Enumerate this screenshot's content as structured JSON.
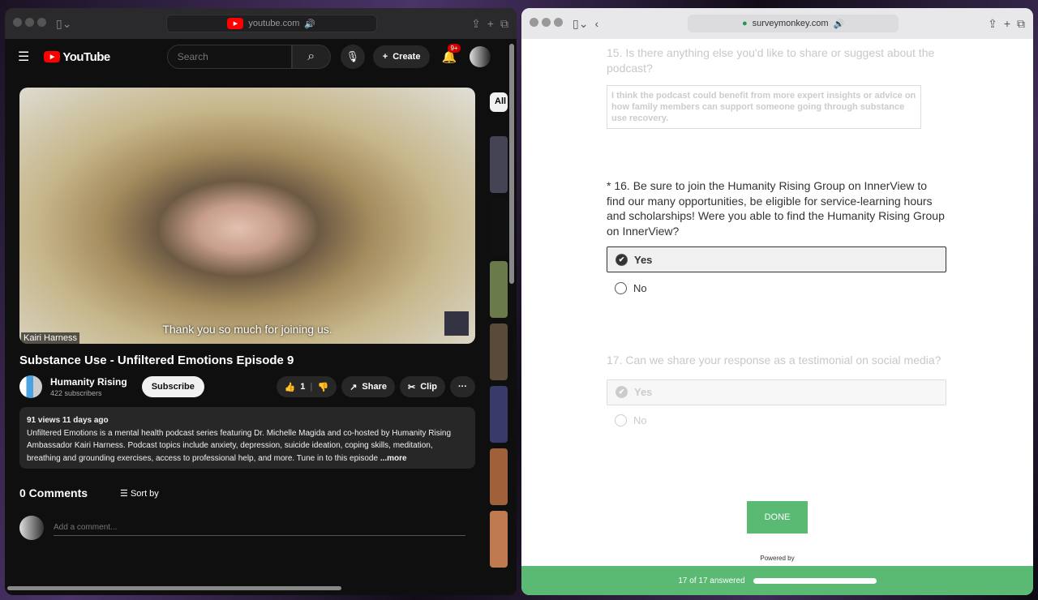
{
  "youtube_window": {
    "url": "youtube.com",
    "logo": "YouTube",
    "search_placeholder": "Search",
    "create": "Create",
    "notif_count": "9+",
    "video": {
      "caption": "Thank you so much for joining us.",
      "name_tag": "Kairi Harness",
      "title": "Substance Use - Unfiltered Emotions Episode 9"
    },
    "channel": {
      "name": "Humanity Rising",
      "subscribers": "422 subscribers",
      "subscribe": "Subscribe"
    },
    "actions": {
      "likes": "1",
      "share": "Share",
      "clip": "Clip",
      "more": "···"
    },
    "description": {
      "meta": "91 views  11 days ago",
      "text": "Unfiltered Emotions is a mental health podcast series featuring Dr. Michelle Magida and co-hosted by Humanity Rising Ambassador Kairi Harness. Podcast topics include anxiety, depression, suicide ideation, coping skills, meditation, breathing and grounding exercises, access to professional help, and more. Tune in to this episode",
      "more": "...more"
    },
    "comments": {
      "count": "0 Comments",
      "sort": "Sort by",
      "placeholder": "Add a comment..."
    },
    "sidebar": {
      "chip": "All"
    }
  },
  "survey_window": {
    "url": "surveymonkey.com",
    "q15": {
      "text": "15. Is there anything else you'd like to share or suggest about the podcast?",
      "answer": "I think the podcast could benefit from more expert insights or advice on how family members can support someone going through substance use recovery."
    },
    "q16": {
      "text": "* 16. Be sure to join the Humanity Rising Group on InnerView to find our many opportunities, be eligible for service-learning hours and scholarships! Were you able to find the Humanity Rising Group on InnerView?",
      "options": [
        "Yes",
        "No"
      ],
      "selected": "Yes"
    },
    "q17": {
      "text": "17. Can we share your response as a testimonial on social media?",
      "options": [
        "Yes",
        "No"
      ],
      "selected": "Yes"
    },
    "done": "DONE",
    "powered_by": "Powered by",
    "progress": {
      "label": "17 of 17 answered",
      "fraction": 1.0
    },
    "accent": "#5aba73"
  }
}
